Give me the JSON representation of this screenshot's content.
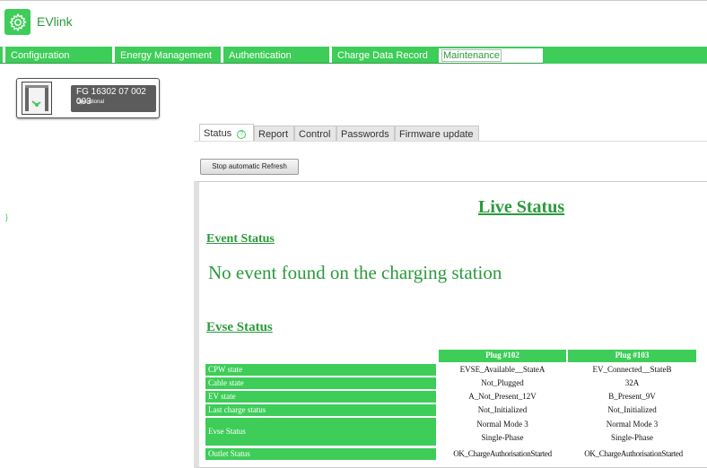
{
  "app": {
    "brand": "EVlink",
    "logo_icon": "gear-icon"
  },
  "nav": {
    "tabs": [
      {
        "label": "Configuration"
      },
      {
        "label": "Energy Management"
      },
      {
        "label": "Authentication"
      },
      {
        "label": "Charge Data Record"
      },
      {
        "label": "Maintenance",
        "active": true
      }
    ]
  },
  "station": {
    "id": "FG 16302 07 002 003",
    "status": "Operational",
    "icon": "charging-station-icon"
  },
  "sidebar": {
    "brace": "}"
  },
  "subtabs": [
    {
      "label": "Status",
      "active": true,
      "icon": "help-icon",
      "icon_glyph": "?"
    },
    {
      "label": "Report"
    },
    {
      "label": "Control"
    },
    {
      "label": "Passwords"
    },
    {
      "label": "Firmware update"
    }
  ],
  "refresh_button": "Stop automatic Refresh",
  "live_status": {
    "title": "Live Status",
    "event_heading": "Event Status",
    "event_message": "No event found on the charging station",
    "evse_heading": "Evse Status"
  },
  "evse_table": {
    "columns": [
      "Plug #102",
      "Plug #103"
    ],
    "rows": [
      {
        "label": "CPW state",
        "values": [
          "EVSE_Available__StateA",
          "EV_Connected__StateB"
        ]
      },
      {
        "label": "Cable state",
        "values": [
          "Not_Plugged",
          "32A"
        ]
      },
      {
        "label": "EV state",
        "values": [
          "A_Not_Present_12V",
          "B_Present_9V"
        ]
      },
      {
        "label": "Last charge status",
        "values": [
          "Not_Initialized",
          "Not_Initialized"
        ]
      },
      {
        "label": "Evse Status",
        "values": [
          [
            "Normal Mode 3",
            "Single-Phase"
          ],
          [
            "Normal Mode 3",
            "Single-Phase"
          ]
        ]
      },
      {
        "label": "Outlet Status",
        "values": [
          "OK_ChargeAuthorisationStarted",
          "OK_ChargeAuthorisationStarted"
        ]
      }
    ]
  },
  "colors": {
    "accent": "#3dcd58",
    "accent_dark": "#2b9a3c",
    "station_label_bg": "#5c5c5c"
  }
}
